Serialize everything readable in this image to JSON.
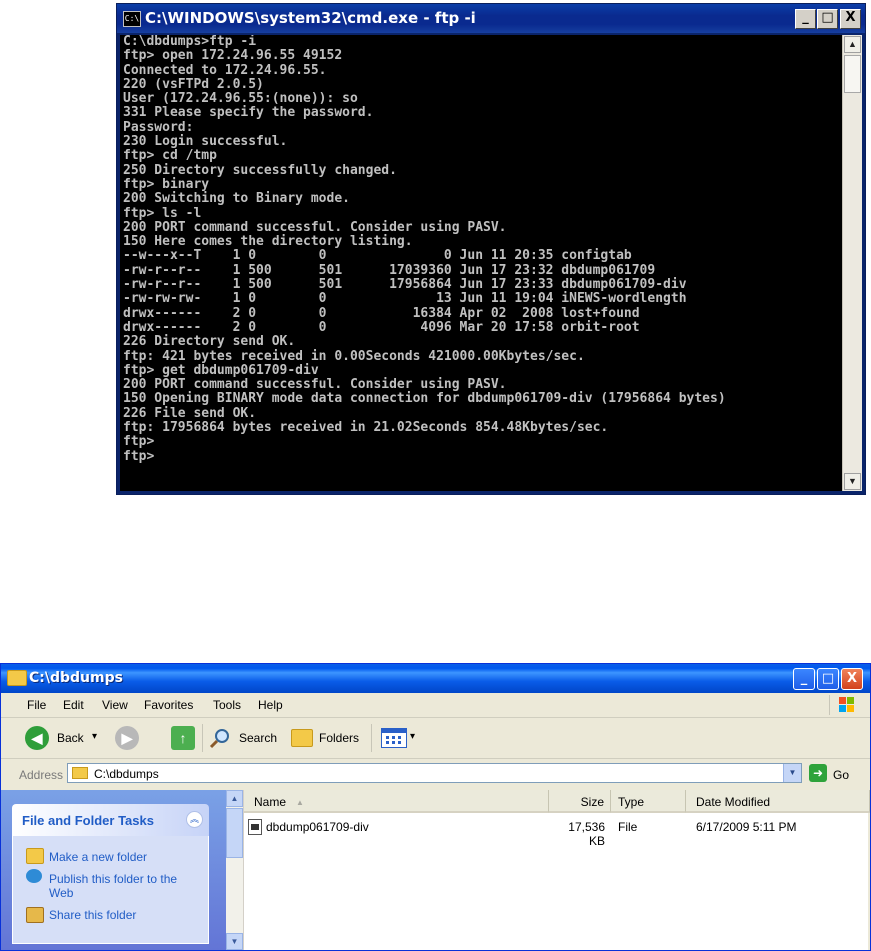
{
  "cmd": {
    "title": "C:\\WINDOWS\\system32\\cmd.exe - ftp -i",
    "icon_text": "C:\\",
    "buttons": {
      "minimize": "_",
      "maximize": "□",
      "close": "X"
    },
    "lines": [
      "C:\\dbdumps>ftp -i",
      "ftp> open 172.24.96.55 49152",
      "Connected to 172.24.96.55.",
      "220 (vsFTPd 2.0.5)",
      "User (172.24.96.55:(none)): so",
      "331 Please specify the password.",
      "Password:",
      "230 Login successful.",
      "ftp> cd /tmp",
      "250 Directory successfully changed.",
      "ftp> binary",
      "200 Switching to Binary mode.",
      "ftp> ls -l",
      "200 PORT command successful. Consider using PASV.",
      "150 Here comes the directory listing.",
      "--w---x--T    1 0        0               0 Jun 11 20:35 configtab",
      "-rw-r--r--    1 500      501      17039360 Jun 17 23:32 dbdump061709",
      "-rw-r--r--    1 500      501      17956864 Jun 17 23:33 dbdump061709-div",
      "-rw-rw-rw-    1 0        0              13 Jun 11 19:04 iNEWS-wordlength",
      "drwx------    2 0        0           16384 Apr 02  2008 lost+found",
      "drwx------    2 0        0            4096 Mar 20 17:58 orbit-root",
      "226 Directory send OK.",
      "ftp: 421 bytes received in 0.00Seconds 421000.00Kbytes/sec.",
      "ftp> get dbdump061709-div",
      "200 PORT command successful. Consider using PASV.",
      "150 Opening BINARY mode data connection for dbdump061709-div (17956864 bytes)",
      "226 File send OK.",
      "ftp: 17956864 bytes received in 21.02Seconds 854.48Kbytes/sec.",
      "ftp>",
      "ftp>"
    ],
    "scroll_up": "▲",
    "scroll_down": "▼"
  },
  "explorer": {
    "title": "C:\\dbdumps",
    "buttons": {
      "minimize": "_",
      "maximize": "□",
      "close": "X"
    },
    "menu": [
      "File",
      "Edit",
      "View",
      "Favorites",
      "Tools",
      "Help"
    ],
    "toolbar": {
      "back": "Back",
      "back_arrow": "▾",
      "search": "Search",
      "folders": "Folders",
      "views_arrow": "▾"
    },
    "address": {
      "label": "Address",
      "value": "C:\\dbdumps",
      "go": "Go",
      "dropdown": "▼"
    },
    "tasks": {
      "title": "File and Folder Tasks",
      "chevron": "︽",
      "items": [
        "Make a new folder",
        "Publish this folder to the Web",
        "Share this folder"
      ]
    },
    "columns": {
      "name": "Name",
      "sort": "▲",
      "size": "Size",
      "type": "Type",
      "date": "Date Modified"
    },
    "files": [
      {
        "name": "dbdump061709-div",
        "size": "17,536 KB",
        "type": "File",
        "date": "6/17/2009 5:11 PM"
      }
    ]
  }
}
